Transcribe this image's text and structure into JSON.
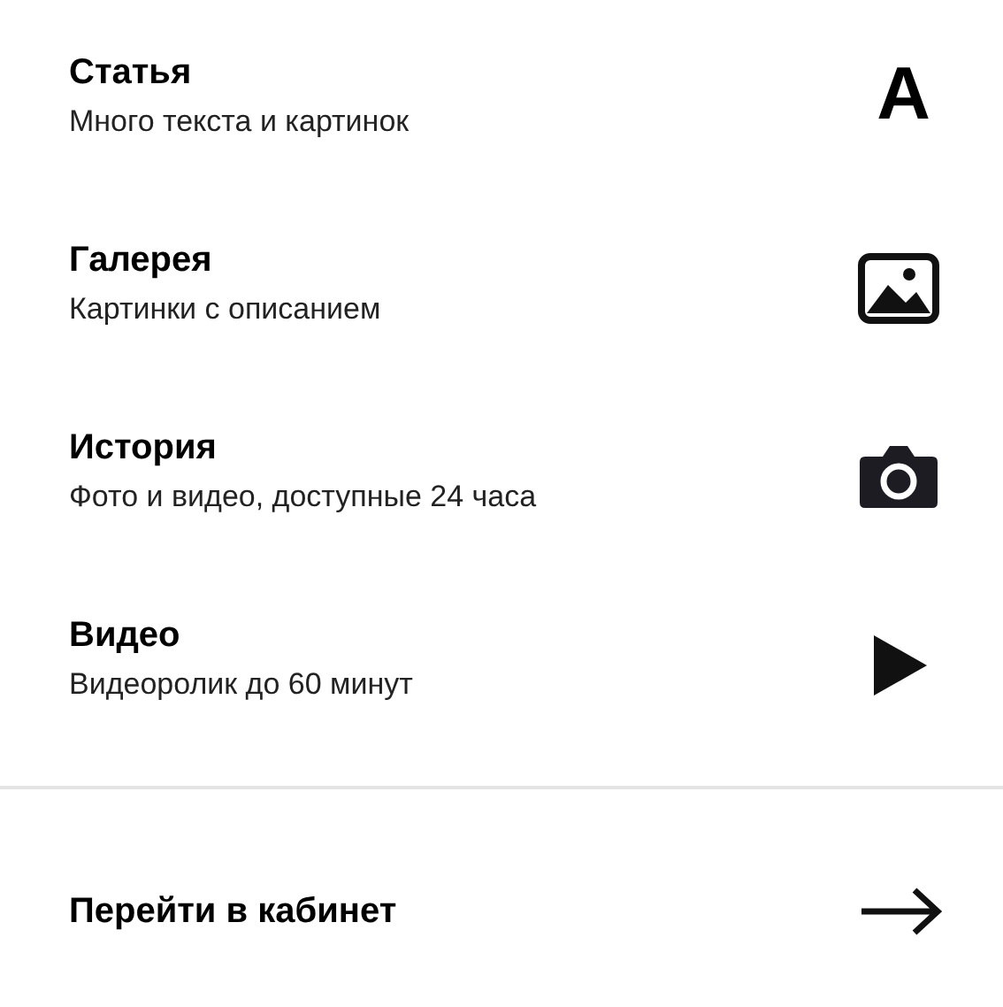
{
  "items": [
    {
      "title": "Статья",
      "subtitle": "Много текста и картинок",
      "kind": "letter",
      "icon_char": "A"
    },
    {
      "title": "Галерея",
      "subtitle": "Картинки с описанием",
      "kind": "image"
    },
    {
      "title": "История",
      "subtitle": "Фото и видео, доступные 24 часа",
      "kind": "camera"
    },
    {
      "title": "Видео",
      "subtitle": "Видеоролик до 60 минут",
      "kind": "play"
    }
  ],
  "footer": {
    "label": "Перейти в кабинет"
  }
}
